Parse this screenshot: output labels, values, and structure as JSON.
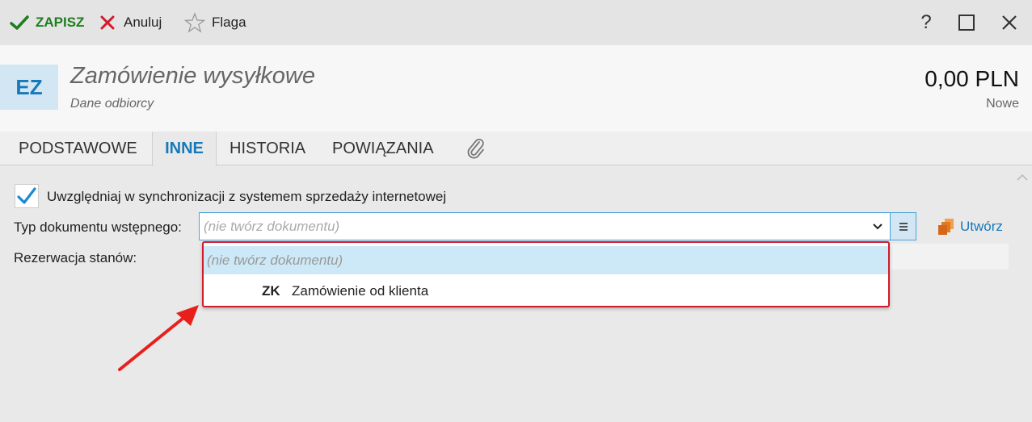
{
  "toolbar": {
    "save_label": "ZAPISZ",
    "cancel_label": "Anuluj",
    "flag_label": "Flaga",
    "help_label": "?"
  },
  "header": {
    "badge": "EZ",
    "title": "Zamówienie wysyłkowe",
    "subtitle": "Dane odbiorcy",
    "amount": "0,00 PLN",
    "status": "Nowe"
  },
  "tabs": {
    "basic": "PODSTAWOWE",
    "other": "INNE",
    "history": "HISTORIA",
    "relations": "POWIĄZANIA",
    "active": "INNE"
  },
  "form": {
    "sync_label": "Uwzględniaj w synchronizacji z systemem sprzedaży internetowej",
    "sync_checked": true,
    "type_label": "Typ dokumentu wstępnego:",
    "type_value": "(nie twórz dokumentu)",
    "create_label": "Utwórz",
    "reserve_label": "Rezerwacja stanów:"
  },
  "dropdown": {
    "options": [
      {
        "code": "",
        "name": "(nie twórz dokumentu)",
        "selected": true
      },
      {
        "code": "ZK",
        "name": "Zamówienie od klienta",
        "selected": false
      }
    ]
  },
  "colors": {
    "accent": "#1779ba",
    "save_green": "#1e7d1e",
    "cancel_red": "#d21a2c",
    "highlight_border": "#d21a2c",
    "selected_option_bg": "#cde8f6",
    "annotation_arrow": "#e8201c"
  }
}
